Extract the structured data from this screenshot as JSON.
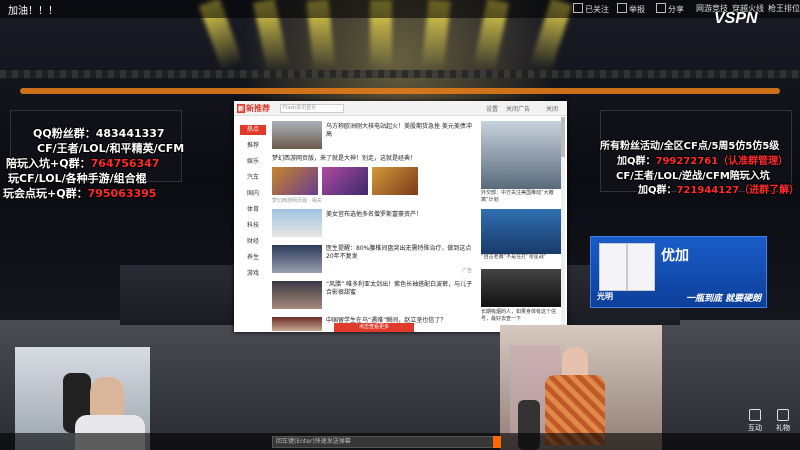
{
  "room": {
    "title": "加油！！！"
  },
  "topbar": {
    "items": [
      "已关注",
      "举报",
      "分享",
      "网游竞技",
      "穿越火线",
      "枪王排位"
    ],
    "logo": "VSPN"
  },
  "overlay_left": {
    "qq_group_label": "QQ粉丝群：",
    "qq_group_number": "483441337",
    "games_line": "CF/王者/LOL/和平精英/CFM",
    "lead_group_label": "陪玩入坑+Q群：",
    "lead_group_number": "764756347",
    "play_line": "玩CF/LOL/各种手游/组合棍",
    "extra_label": "玩会点玩+Q群：",
    "extra_number": "795063395"
  },
  "overlay_right": {
    "line1": "所有粉丝活动/全区CF点/5周5仿5仿5级",
    "line2_label": "加Q群：",
    "line2_number": "799272761",
    "line2_note": "（认准群管理）",
    "line3": "CF/王者/LOL/逆战/CFM陪玩入坑",
    "line4_label": "加Q群：",
    "line4_number": "721944127",
    "line4_note": "（进群了解）"
  },
  "browser": {
    "logo_badge": "新",
    "logo_text": "新推荐",
    "search_placeholder": "Flash资讯首页",
    "header_links": [
      "设置",
      "关闭广告",
      "关闭"
    ],
    "sidebar": [
      "热点",
      "推荐",
      "娱乐",
      "汽车",
      "国内",
      "体育",
      "科技",
      "财经",
      "养生",
      "游戏"
    ],
    "news": [
      {
        "title": "乌方称欧洲刚大核电站起火！美股期货急挫 美元美债冲高",
        "meta": ""
      },
      {
        "title": "梦幻西游网页版，来了就是大神！别走，这就是经典！",
        "meta": "梦幻西游网页版 · 相关"
      },
      {
        "title": "美女宫布选他多名僧罗斯富豪资产！",
        "meta": ""
      },
      {
        "title": "医生提醒：80%腰椎间盘突出无需特殊治疗，做到这点20年不复发",
        "meta": "广告"
      },
      {
        "title": "“风腊” 唯多利亚太剑出！紫色长袖搭配白波裤，与儿子合影很甜蜜",
        "meta": ""
      },
      {
        "title": "中国留学生在乌“遇难”瞬间，赵立坚也信了？",
        "meta": ""
      }
    ],
    "side_captions": [
      "外交部：中方关注美国推动“大撤离”计划",
      "“自古老撤”不是在打“零星战”",
      "长期吸烟的人，如果身体有这个信号，最好去查一下"
    ],
    "bottom_banner": "点击查看更多"
  },
  "ad": {
    "brand": "优加",
    "sub_brand": "光明",
    "slogan": "一瓶到底 就要硬朗"
  },
  "chat": {
    "placeholder": "回车键(Enter)快速发送弹幕"
  },
  "right_buttons": [
    {
      "label": "互动"
    },
    {
      "label": "礼物"
    }
  ],
  "colors": {
    "accent_red": "#ff2a2a",
    "accent_yellow": "#ffd21a",
    "brand_red": "#e03a2a",
    "send_orange": "#ff6a00"
  }
}
